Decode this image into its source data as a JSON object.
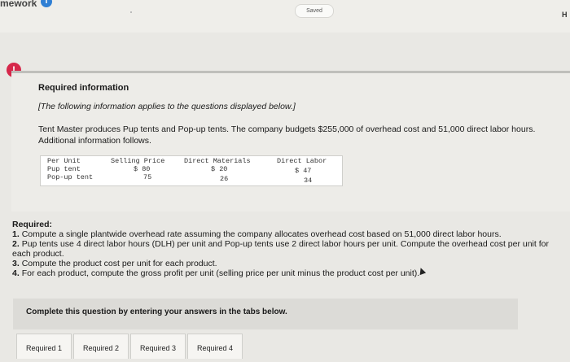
{
  "header": {
    "brand": "mework",
    "status": "Saved",
    "help_short": "H"
  },
  "info": {
    "title": "Required information",
    "note": "[The following information applies to the questions displayed below.]",
    "description": "Tent Master produces Pup tents and Pop-up tents. The company budgets $255,000 of overhead cost and 51,000 direct labor hours. Additional information follows."
  },
  "table": {
    "headers": [
      "Per Unit",
      "Selling Price",
      "Direct Materials",
      "Direct Labor"
    ],
    "rows": [
      {
        "product": "Pup tent",
        "selling_price": "$ 80",
        "direct_materials": "$ 20",
        "direct_labor": "$ 47"
      },
      {
        "product": "Pop-up tent",
        "selling_price": "75",
        "direct_materials": "26",
        "direct_labor": "34"
      }
    ]
  },
  "required": {
    "heading": "Required:",
    "items": [
      {
        "num": "1.",
        "text": "Compute a single plantwide overhead rate assuming the company allocates overhead cost based on 51,000 direct labor hours."
      },
      {
        "num": "2.",
        "text": "Pup tents use 4 direct labor hours (DLH) per unit and Pop-up tents use 2 direct labor hours per unit. Compute the overhead cost per unit for each product."
      },
      {
        "num": "3.",
        "text": "Compute the product cost per unit for each product."
      },
      {
        "num": "4.",
        "text": "For each product, compute the gross profit per unit (selling price per unit minus the product cost per unit)."
      }
    ]
  },
  "instructions": "Complete this question by entering your answers in the tabs below.",
  "tabs": [
    "Required 1",
    "Required 2",
    "Required 3",
    "Required 4"
  ],
  "colors": {
    "alert": "#d6274a",
    "info": "#2f7fd4"
  }
}
